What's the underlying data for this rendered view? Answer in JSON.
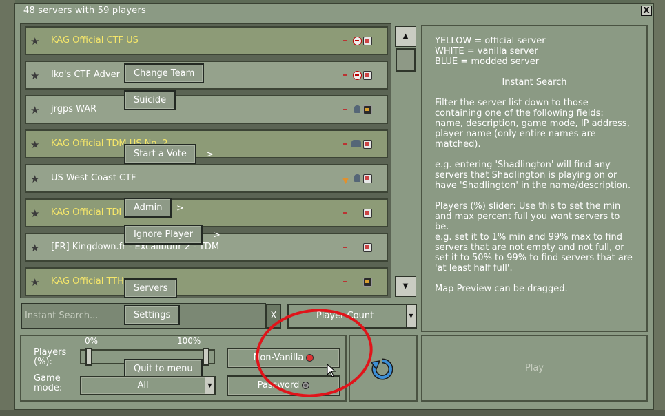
{
  "window": {
    "title": "48 servers with 59 players",
    "close_label": "X"
  },
  "servers": [
    {
      "name": "KAG Official CTF US",
      "kind": "official"
    },
    {
      "name": "Iko's CTF Adver",
      "kind": "vanilla"
    },
    {
      "name": "jrgps WAR",
      "kind": "vanilla"
    },
    {
      "name": "KAG Official TDM US No. 2",
      "kind": "official"
    },
    {
      "name": "US West Coast CTF",
      "kind": "vanilla"
    },
    {
      "name": "KAG Official TDI",
      "kind": "official"
    },
    {
      "name": "[FR] Kingdown.fr - Excalibuur 2 - TDM",
      "kind": "vanilla"
    },
    {
      "name": "KAG Official TTH",
      "kind": "official"
    }
  ],
  "context_menu": {
    "change_team": "Change Team",
    "suicide": "Suicide",
    "start_vote": "Start a Vote",
    "admin": "Admin",
    "ignore_player": "Ignore Player",
    "servers": "Servers",
    "settings": "Settings",
    "quit": "Quit to menu",
    "submenu_arrow": ">"
  },
  "search": {
    "placeholder": "Instant Search...",
    "clear_label": "X"
  },
  "sort": {
    "selected": "Player Count"
  },
  "filters": {
    "players_label": "Players (%):",
    "min_label": "0%",
    "max_label": "100%",
    "min_value": 0,
    "max_value": 100,
    "game_mode_label": "Game mode:",
    "game_mode_value": "All",
    "non_vanilla_label": "Non-Vanilla",
    "password_label": "Password"
  },
  "info": {
    "legend_yellow": "YELLOW = official server",
    "legend_white": "WHITE = vanilla server",
    "legend_blue": "BLUE = modded server",
    "heading": "Instant Search",
    "para1": "Filter the server list down to those containing one of the following fields: name, description, game mode, IP address, player name (only entire names are matched).",
    "para2": "e.g. entering 'Shadlington' will find any servers that Shadlington is playing on or have 'Shadlington' in the name/description.",
    "para3": "Players (%) slider: Use this to set the min and max percent full you want servers to be.\ne.g. set it to 1% min and 99% max to find servers that are not empty and not full, or set it to 50% to 99% to find servers that are 'at least half full'.",
    "para4": "Map Preview can be dragged."
  },
  "play": {
    "label": "Play"
  },
  "colors": {
    "official": "#f5e66a",
    "vanilla": "#ffffff",
    "annotation": "#e0141a"
  }
}
